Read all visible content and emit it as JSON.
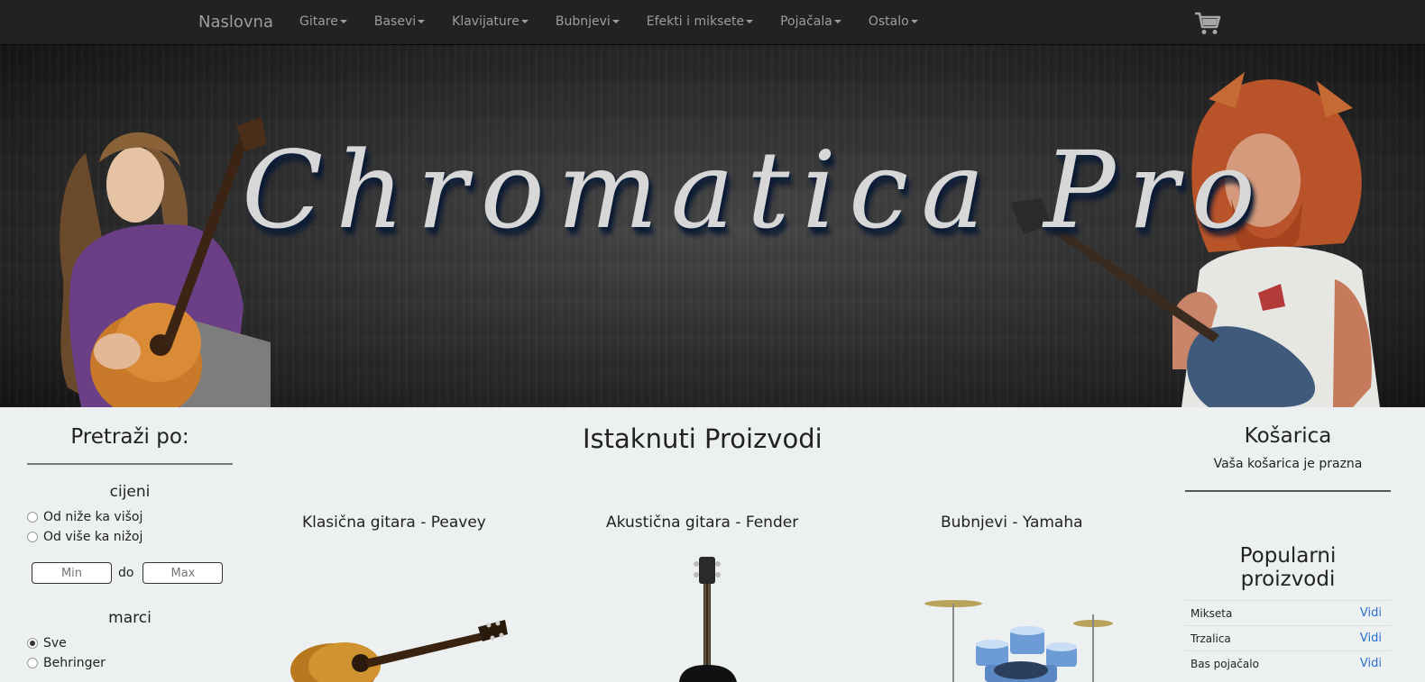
{
  "navbar": {
    "brand": "Naslovna",
    "items": [
      "Gitare",
      "Basevi",
      "Klavijature",
      "Bubnjevi",
      "Efekti i miksete",
      "Pojačala",
      "Ostalo"
    ],
    "cart_icon": "shopping-cart-icon"
  },
  "banner": {
    "title": "Chromatica Pro"
  },
  "filter": {
    "title": "Pretraži po:",
    "price_heading": "cijeni",
    "price_options": [
      "Od niže ka višoj",
      "Od više ka nižoj"
    ],
    "min_placeholder": "Min",
    "max_placeholder": "Max",
    "between": "do",
    "brand_heading": "marci",
    "brand_options": [
      "Sve",
      "Behringer"
    ],
    "selected_brand": "Sve"
  },
  "main": {
    "title": "Istaknuti Proizvodi",
    "products": [
      {
        "name": "Klasična gitara - Peavey"
      },
      {
        "name": "Akustična gitara - Fender"
      },
      {
        "name": "Bubnjevi - Yamaha"
      }
    ]
  },
  "cart": {
    "title": "Košarica",
    "empty_text": "Vaša košarica je prazna"
  },
  "popular": {
    "title_line1": "Popularni",
    "title_line2": "proizvodi",
    "items": [
      {
        "name": "Mikseta",
        "action": "Vidi"
      },
      {
        "name": "Trzalica",
        "action": "Vidi"
      },
      {
        "name": "Bas pojačalo",
        "action": "Vidi"
      }
    ]
  },
  "colors": {
    "navbar_bg": "#222222",
    "nav_text": "#9d9d9d",
    "page_bg": "#ecf0f1",
    "link": "#2a6fd0"
  }
}
